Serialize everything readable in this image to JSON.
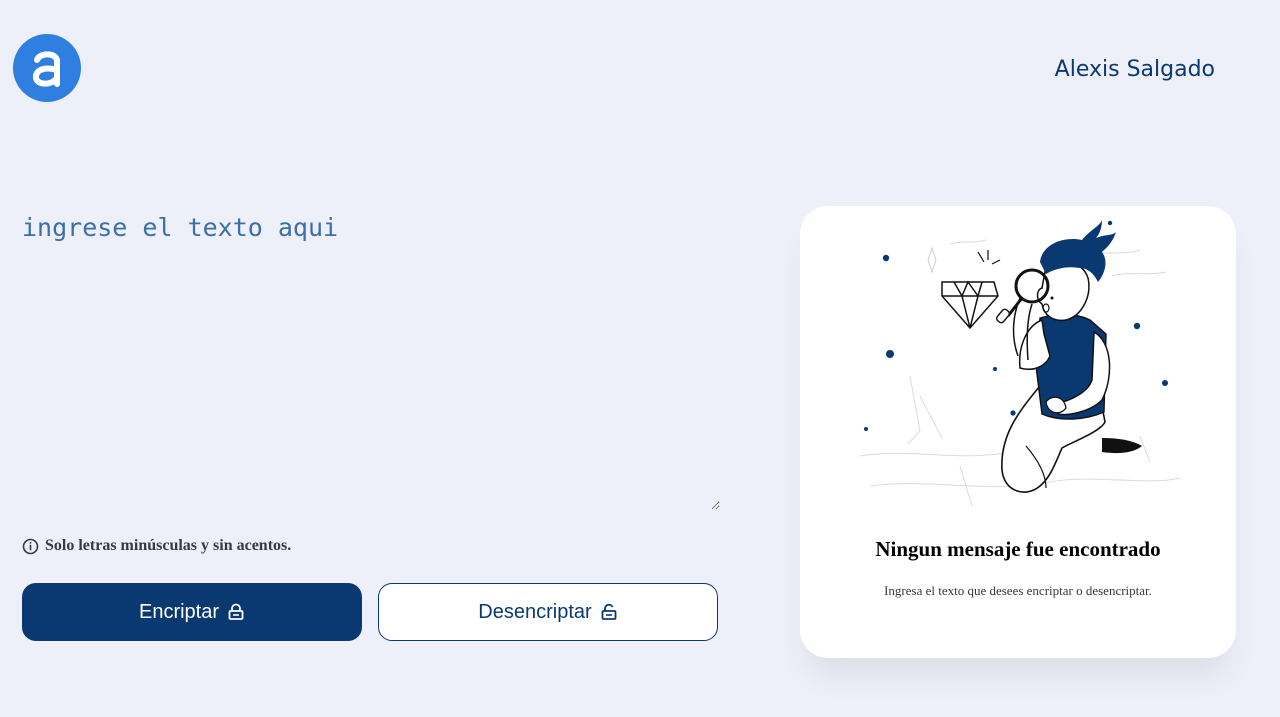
{
  "header": {
    "logo_letter": "a",
    "user_name": "Alexis Salgado"
  },
  "editor": {
    "placeholder": "ingrese el texto aqui",
    "value": ""
  },
  "hint": {
    "text": "Solo letras minúsculas y sin acentos."
  },
  "buttons": {
    "encrypt_label": "Encriptar",
    "decrypt_label": "Desencriptar"
  },
  "output": {
    "title": "Ningun mensaje fue encontrado",
    "subtitle": "Ingresa el texto que desees encriptar o desencriptar."
  },
  "colors": {
    "background": "#eef0f9",
    "primary": "#0a3871",
    "logo": "#2f7fe0",
    "placeholder": "#3c6ea8"
  },
  "icons": {
    "logo": "alura-logo-icon",
    "hint": "info-circle-icon",
    "encrypt": "lock-closed-icon",
    "decrypt": "lock-open-icon",
    "illustration": "person-with-magnifier-illustration"
  }
}
